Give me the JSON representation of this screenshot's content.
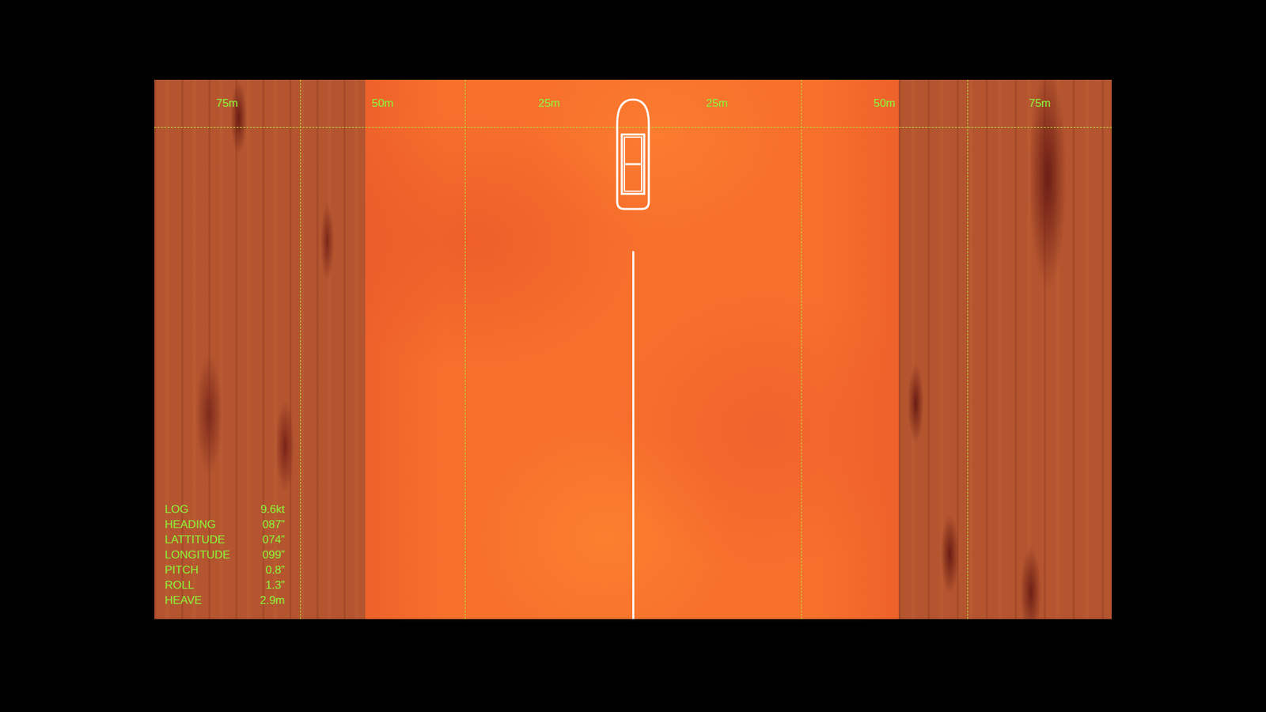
{
  "scale": {
    "labels": [
      "75m",
      "50m",
      "25m",
      "25m",
      "50m",
      "75m"
    ]
  },
  "readouts": [
    {
      "label": "LOG",
      "value": "9.6kt"
    },
    {
      "label": "HEADING",
      "value": "087”"
    },
    {
      "label": "LATTITUDE",
      "value": "074”"
    },
    {
      "label": "LONGITUDE",
      "value": "099”"
    },
    {
      "label": "PITCH",
      "value": "0.8”"
    },
    {
      "label": "ROLL",
      "value": "1.3”"
    },
    {
      "label": "HEAVE",
      "value": "2.9m"
    }
  ]
}
